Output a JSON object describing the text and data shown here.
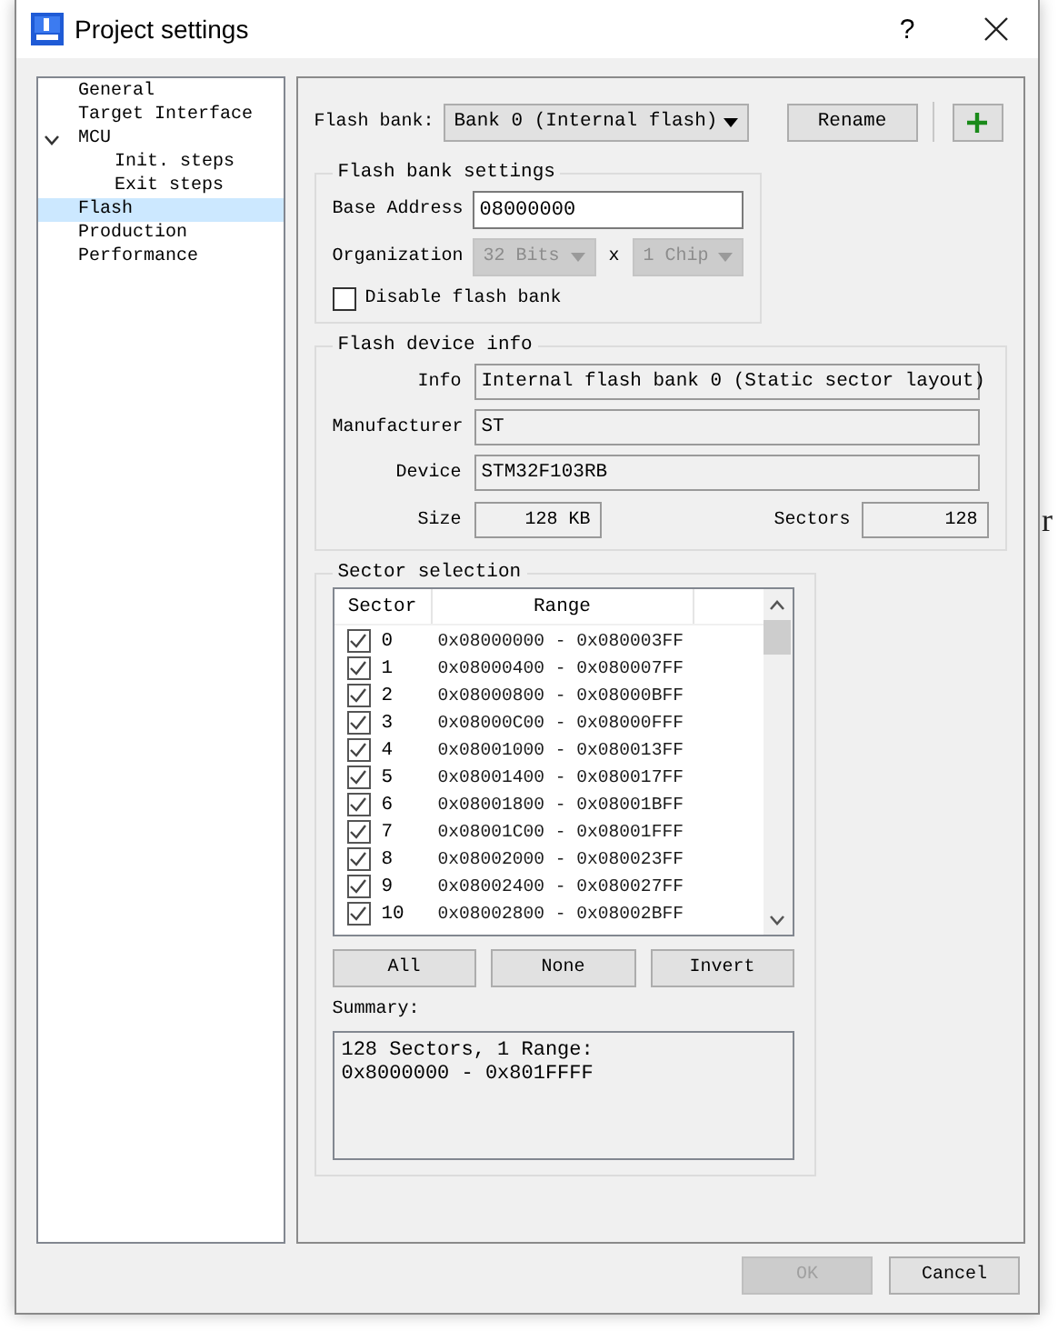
{
  "window": {
    "title": "Project settings",
    "help": "?"
  },
  "tree": [
    {
      "label": "General",
      "selected": false
    },
    {
      "label": "Target Interface",
      "selected": false
    },
    {
      "label": "MCU",
      "selected": false,
      "expanded": true,
      "children": [
        {
          "label": "Init. steps",
          "selected": false
        },
        {
          "label": "Exit steps",
          "selected": false
        }
      ]
    },
    {
      "label": "Flash",
      "selected": true
    },
    {
      "label": "Production",
      "selected": false
    },
    {
      "label": "Performance",
      "selected": false
    }
  ],
  "flash_bank": {
    "label": "Flash bank:",
    "value": "Bank 0 (Internal flash)",
    "rename": "Rename"
  },
  "bank_settings": {
    "title": "Flash bank settings",
    "base_address_label": "Base Address",
    "base_address": "08000000",
    "organization_label": "Organization",
    "bits": "32 Bits",
    "times": "x",
    "chips": "1 Chip",
    "organization_disabled": true,
    "disable_bank": {
      "label": "Disable flash bank",
      "checked": false
    }
  },
  "device_info": {
    "title": "Flash device info",
    "fields": [
      {
        "label": "Info",
        "value": "Internal flash bank 0 (Static sector layout)"
      },
      {
        "label": "Manufacturer",
        "value": "ST"
      },
      {
        "label": "Device",
        "value": "STM32F103RB"
      }
    ],
    "size_label": "Size",
    "size": "128 KB",
    "sectors_label": "Sectors",
    "sectors": "128"
  },
  "sector_selection": {
    "title": "Sector selection",
    "columns": [
      "Sector",
      "Range"
    ],
    "rows": [
      {
        "sector": "0",
        "range": "0x08000000 - 0x080003FF",
        "checked": true
      },
      {
        "sector": "1",
        "range": "0x08000400 - 0x080007FF",
        "checked": true
      },
      {
        "sector": "2",
        "range": "0x08000800 - 0x08000BFF",
        "checked": true
      },
      {
        "sector": "3",
        "range": "0x08000C00 - 0x08000FFF",
        "checked": true
      },
      {
        "sector": "4",
        "range": "0x08001000 - 0x080013FF",
        "checked": true
      },
      {
        "sector": "5",
        "range": "0x08001400 - 0x080017FF",
        "checked": true
      },
      {
        "sector": "6",
        "range": "0x08001800 - 0x08001BFF",
        "checked": true
      },
      {
        "sector": "7",
        "range": "0x08001C00 - 0x08001FFF",
        "checked": true
      },
      {
        "sector": "8",
        "range": "0x08002000 - 0x080023FF",
        "checked": true
      },
      {
        "sector": "9",
        "range": "0x08002400 - 0x080027FF",
        "checked": true
      },
      {
        "sector": "10",
        "range": "0x08002800 - 0x08002BFF",
        "checked": true
      }
    ],
    "buttons": [
      "All",
      "None",
      "Invert"
    ],
    "summary_label": "Summary:",
    "summary": [
      "128 Sectors, 1 Range:",
      "0x8000000 - 0x801FFFF"
    ]
  },
  "footer": [
    {
      "label": "OK",
      "disabled": true
    },
    {
      "label": "Cancel",
      "disabled": false
    }
  ],
  "background_text": "r"
}
